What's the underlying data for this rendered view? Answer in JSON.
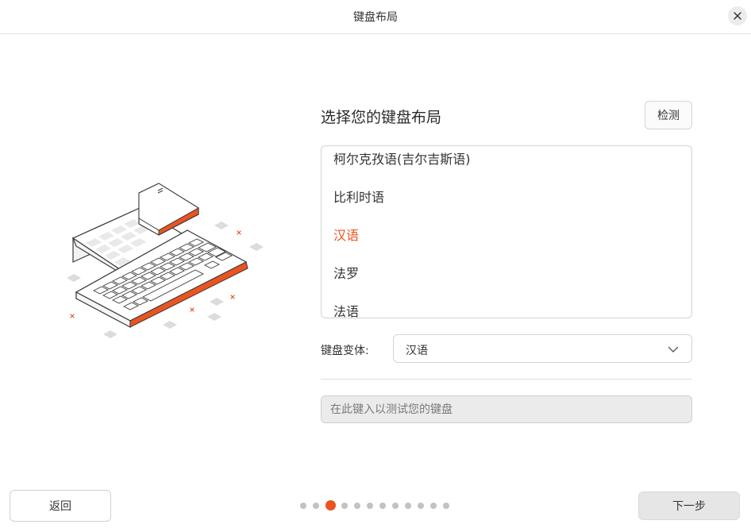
{
  "window": {
    "title": "键盘布局",
    "close_icon": "close-icon"
  },
  "main": {
    "heading": "选择您的键盘布局",
    "detect_label": "检测",
    "layouts": [
      "柯尔克孜语(吉尔吉斯语)",
      "比利时语",
      "汉语",
      "法罗",
      "法语"
    ],
    "selected_layout": "汉语",
    "variant_label": "键盘变体:",
    "variant_value": "汉语",
    "test_placeholder": "在此键入以测试您的键盘"
  },
  "footer": {
    "back_label": "返回",
    "next_label": "下一步",
    "page_count": 12,
    "current_page": 3
  },
  "colors": {
    "accent": "#e95420",
    "dot_inactive": "#c2c2c2",
    "next_button_bg": "#e6e6e6"
  }
}
